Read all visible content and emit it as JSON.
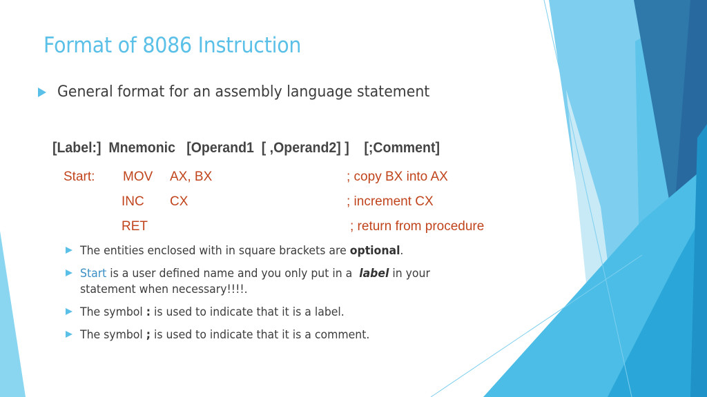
{
  "slide": {
    "title": "Format of 8086 Instruction",
    "main_bullet": "General format for an assembly language statement",
    "format_line": "[Label:]  Mnemonic   [Operand1  [ ,Operand2] ]    [;Comment]",
    "code_example": [
      {
        "label": "Start:",
        "mnemonic": "MOV",
        "operands": "AX, BX",
        "comment": "; copy BX into AX"
      },
      {
        "label": "",
        "mnemonic": "INC",
        "operands": "CX",
        "comment": "; increment CX"
      },
      {
        "label": "",
        "mnemonic": "RET",
        "operands": "",
        "comment": "; return from procedure"
      }
    ],
    "sub_bullets": [
      {
        "pre": "The entities enclosed with in square brackets are ",
        "bold": "optional",
        "post": "."
      },
      {
        "highlight": "Start",
        "pre": " is a user defined name and you only put in a  ",
        "italic": "label",
        "post": " in your statement when necessary!!!!."
      },
      {
        "pre": "The symbol ",
        "bold": ":",
        "post": " is used to indicate that it is a label."
      },
      {
        "pre": "The symbol ",
        "bold": ";",
        "post": " is used to indicate that it is a comment."
      }
    ]
  },
  "theme": {
    "accent": "#5bc0e8",
    "code_color": "#c0441c",
    "text_color": "#3c3c3c"
  }
}
